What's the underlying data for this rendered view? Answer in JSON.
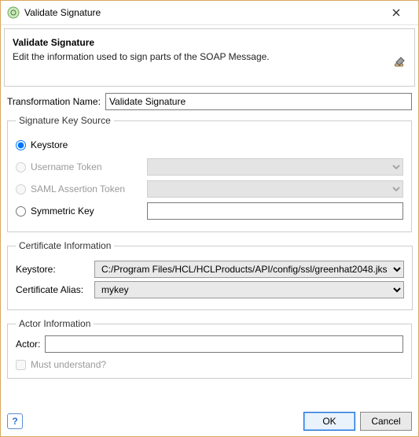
{
  "window": {
    "title": "Validate Signature"
  },
  "header": {
    "title": "Validate Signature",
    "subtitle": "Edit the information used to sign parts of the SOAP Message."
  },
  "transformation": {
    "label": "Transformation Name:",
    "value": "Validate Signature"
  },
  "keysource": {
    "legend": "Signature Key Source",
    "keystore_label": "Keystore",
    "username_label": "Username Token",
    "saml_label": "SAML Assertion Token",
    "symmetric_label": "Symmetric Key",
    "symmetric_value": ""
  },
  "cert": {
    "legend": "Certificate Information",
    "keystore_label": "Keystore:",
    "keystore_value": "C:/Program Files/HCL/HCLProducts/API/config/ssl/greenhat2048.jks",
    "alias_label": "Certificate Alias:",
    "alias_value": "mykey"
  },
  "actor": {
    "legend": "Actor Information",
    "actor_label": "Actor:",
    "actor_value": "",
    "must_understand_label": "Must understand?"
  },
  "buttons": {
    "ok": "OK",
    "cancel": "Cancel"
  }
}
